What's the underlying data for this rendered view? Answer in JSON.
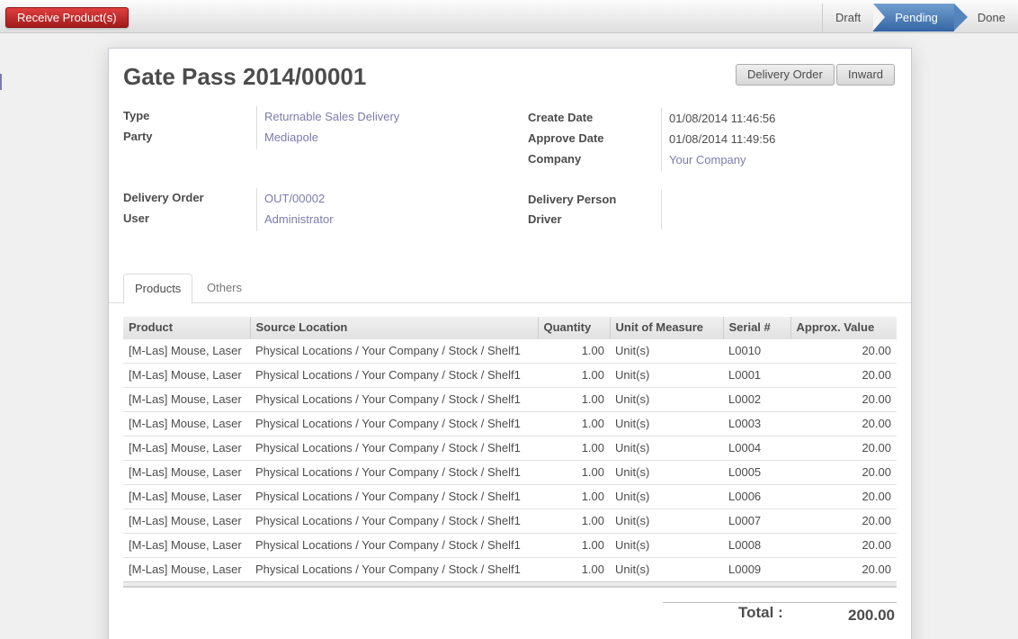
{
  "statusbar": {
    "receive_label": "Receive Product(s)",
    "stages": [
      "Draft",
      "Pending",
      "Done"
    ],
    "active_stage": "Pending"
  },
  "form": {
    "title_prefix": "Gate Pass",
    "title_number": "2014/00001",
    "buttons": {
      "delivery_order": "Delivery Order",
      "inward": "Inward"
    },
    "left": {
      "type_label": "Type",
      "type_value": "Returnable Sales Delivery",
      "party_label": "Party",
      "party_value": "Mediapole",
      "delivery_order_label": "Delivery Order",
      "delivery_order_value": "OUT/00002",
      "user_label": "User",
      "user_value": "Administrator"
    },
    "right": {
      "create_date_label": "Create Date",
      "create_date_value": "01/08/2014 11:46:56",
      "approve_date_label": "Approve Date",
      "approve_date_value": "01/08/2014 11:49:56",
      "company_label": "Company",
      "company_value": "Your Company",
      "delivery_person_label": "Delivery Person",
      "driver_label": "Driver"
    },
    "tabs": [
      "Products",
      "Others"
    ],
    "table": {
      "headers": [
        "Product",
        "Source Location",
        "Quantity",
        "Unit of Measure",
        "Serial #",
        "Approx. Value"
      ],
      "rows": [
        [
          "[M-Las] Mouse, Laser",
          "Physical Locations / Your Company / Stock / Shelf1",
          "1.00",
          "Unit(s)",
          "L0010",
          "20.00"
        ],
        [
          "[M-Las] Mouse, Laser",
          "Physical Locations / Your Company / Stock / Shelf1",
          "1.00",
          "Unit(s)",
          "L0001",
          "20.00"
        ],
        [
          "[M-Las] Mouse, Laser",
          "Physical Locations / Your Company / Stock / Shelf1",
          "1.00",
          "Unit(s)",
          "L0002",
          "20.00"
        ],
        [
          "[M-Las] Mouse, Laser",
          "Physical Locations / Your Company / Stock / Shelf1",
          "1.00",
          "Unit(s)",
          "L0003",
          "20.00"
        ],
        [
          "[M-Las] Mouse, Laser",
          "Physical Locations / Your Company / Stock / Shelf1",
          "1.00",
          "Unit(s)",
          "L0004",
          "20.00"
        ],
        [
          "[M-Las] Mouse, Laser",
          "Physical Locations / Your Company / Stock / Shelf1",
          "1.00",
          "Unit(s)",
          "L0005",
          "20.00"
        ],
        [
          "[M-Las] Mouse, Laser",
          "Physical Locations / Your Company / Stock / Shelf1",
          "1.00",
          "Unit(s)",
          "L0006",
          "20.00"
        ],
        [
          "[M-Las] Mouse, Laser",
          "Physical Locations / Your Company / Stock / Shelf1",
          "1.00",
          "Unit(s)",
          "L0007",
          "20.00"
        ],
        [
          "[M-Las] Mouse, Laser",
          "Physical Locations / Your Company / Stock / Shelf1",
          "1.00",
          "Unit(s)",
          "L0008",
          "20.00"
        ],
        [
          "[M-Las] Mouse, Laser",
          "Physical Locations / Your Company / Stock / Shelf1",
          "1.00",
          "Unit(s)",
          "L0009",
          "20.00"
        ]
      ]
    },
    "total_label": "Total :",
    "total_value": "200.00"
  }
}
